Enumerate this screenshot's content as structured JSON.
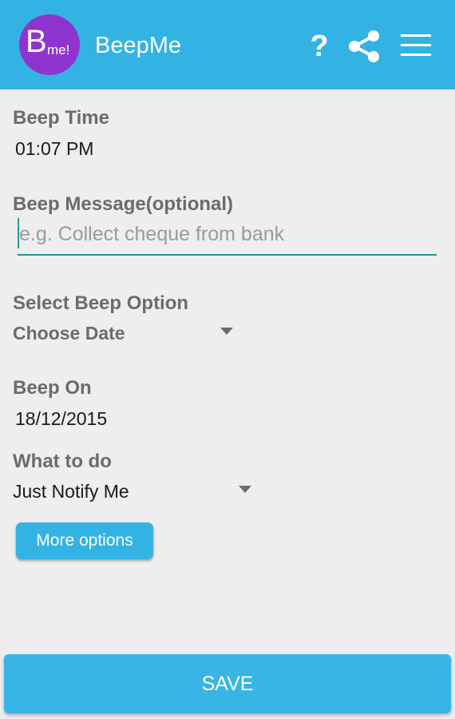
{
  "app": {
    "logo_big": "B",
    "logo_small": "me!",
    "title": "BeepMe",
    "help_icon": "?"
  },
  "icons": {
    "help": "help-icon",
    "share": "share-icon",
    "menu": "hamburger-menu-icon",
    "dropdown": "dropdown-arrow-icon"
  },
  "form": {
    "beep_time": {
      "label": "Beep Time",
      "value": "01:07 PM"
    },
    "beep_message": {
      "label": "Beep Message(optional)",
      "value": "",
      "placeholder": "e.g. Collect cheque from bank"
    },
    "beep_option": {
      "label": "Select Beep Option",
      "selected": "Choose Date"
    },
    "beep_on": {
      "label": "Beep On",
      "value": "18/12/2015"
    },
    "what_to_do": {
      "label": "What to do",
      "selected": "Just Notify Me"
    },
    "more_options_label": "More options",
    "save_label": "SAVE"
  },
  "colors": {
    "primary": "#33b3e3",
    "logo_bg": "#8e35cf",
    "input_accent": "#1a9e8e",
    "background": "#eeeeee"
  }
}
